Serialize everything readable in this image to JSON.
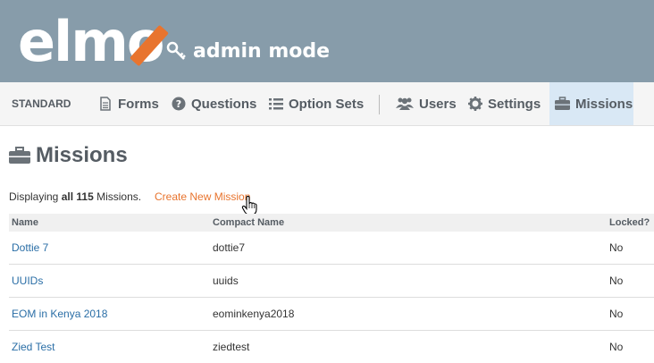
{
  "brand": {
    "logo_text": "elmo",
    "mode_label": "admin mode",
    "accent_color": "#e8742e",
    "header_color": "#879caa"
  },
  "nav": {
    "standard": "STANDARD",
    "items": [
      {
        "label": "Forms",
        "icon": "file-icon"
      },
      {
        "label": "Questions",
        "icon": "question-circle-icon"
      },
      {
        "label": "Option Sets",
        "icon": "list-icon"
      },
      {
        "label": "Users",
        "icon": "users-icon"
      },
      {
        "label": "Settings",
        "icon": "gear-icon"
      },
      {
        "label": "Missions",
        "icon": "briefcase-icon",
        "active": true
      }
    ]
  },
  "page": {
    "title": "Missions",
    "summary_prefix": "Displaying",
    "summary_bold": "all 115",
    "summary_suffix": "Missions.",
    "create_link": "Create New Mission"
  },
  "table": {
    "columns": [
      "Name",
      "Compact Name",
      "Locked?"
    ],
    "rows": [
      {
        "name": "Dottie 7",
        "compact": "dottie7",
        "locked": "No"
      },
      {
        "name": "UUIDs",
        "compact": "uuids",
        "locked": "No"
      },
      {
        "name": "EOM in Kenya 2018",
        "compact": "eominkenya2018",
        "locked": "No"
      },
      {
        "name": "Zied Test",
        "compact": "ziedtest",
        "locked": "No"
      }
    ]
  }
}
